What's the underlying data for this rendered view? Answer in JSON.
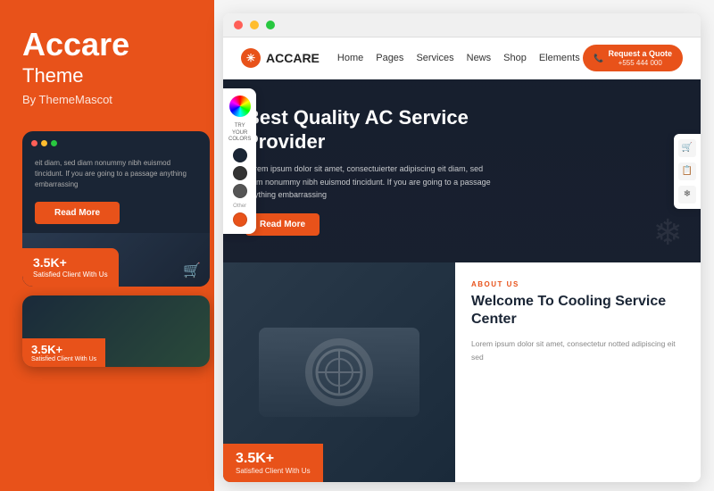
{
  "left": {
    "brand_title": "Accare",
    "brand_sub": "Theme",
    "brand_by": "By ThemeMascot",
    "mobile_text": "eit diam, sed diam nonummy nibh euismod tincidunt. If you are going to a passage anything embarrassing",
    "read_more_label": "Read More",
    "badge_num": "3.5K+",
    "badge_text": "Satisfied Client With Us"
  },
  "right": {
    "browser_dots": [
      "red",
      "yellow",
      "green"
    ],
    "navbar": {
      "logo_text": "ACCARE",
      "links": [
        "Home",
        "Pages",
        "Services",
        "News",
        "Shop",
        "Elements"
      ],
      "quote_label": "Request a Quote",
      "quote_phone": "+555 444 000"
    },
    "hero": {
      "title": "Best Quality AC Service Provider",
      "desc": "Lorem ipsum dolor sit amet, consectuierter adipiscing eit diam, sed diam nonummy nibh euismod tincidunt. If you are going to a passage anything embarrassing",
      "read_more_label": "Read More",
      "nav_left": "❮",
      "nav_right": "❯",
      "snowflake": "❄"
    },
    "color_picker": {
      "label": "TRY YOUR COLORS",
      "swatches": [
        "#e85c1a",
        "#333333",
        "#444444",
        "#555555",
        "#1a9e6e",
        "#e8c81a"
      ]
    },
    "side_toolbar": {
      "icons": [
        "🛒",
        "📋",
        "🔧"
      ]
    },
    "below_hero": {
      "image_badge_num": "3.5K+",
      "image_badge_text": "Satisfied Client With Us",
      "about_label": "ABOUT US",
      "about_title": "Welcome To Cooling Service Center",
      "about_desc": "Lorem ipsum dolor sit amet, consectetur notted adipiscing eit sed"
    }
  }
}
